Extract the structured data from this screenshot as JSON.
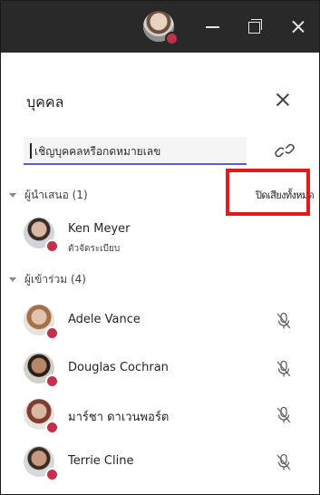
{
  "panel": {
    "title": "บุคคล",
    "search_placeholder": "เชิญบุคคลหรือกดหมายเลข",
    "mute_all_label": "ปิดเสียงทั้งหมด"
  },
  "presenters": {
    "header": "ผู้นำเสนอ (1)",
    "people": [
      {
        "name": "Ken Meyer",
        "role": "ตัวจัดระเบียบ"
      }
    ]
  },
  "attendees": {
    "header": "ผู้เข้าร่วม (4)",
    "people": [
      {
        "name": "Adele Vance"
      },
      {
        "name": "Douglas Cochran"
      },
      {
        "name": "มาร์ชา ดาเวนพอร์ต"
      },
      {
        "name": "Terrie Cline"
      }
    ]
  },
  "colors": {
    "titlebar": "#292929",
    "status_busy": "#c4314b",
    "accent": "#5b5fc7",
    "highlight": "#e8191c"
  }
}
